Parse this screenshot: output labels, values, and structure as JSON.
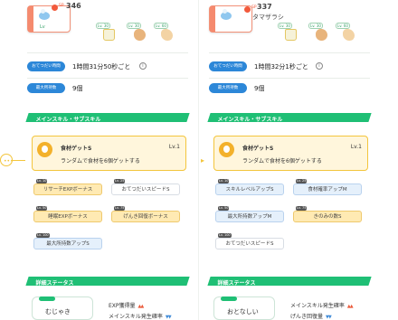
{
  "left": {
    "pokemon": {
      "sp_label": "SP",
      "number": "346",
      "name": "",
      "sub_label": "Lv"
    },
    "foods": [
      {
        "level": "Lv. 30"
      },
      {
        "level": "Lv. 30"
      },
      {
        "level": "Lv. 60"
      }
    ],
    "stats": [
      {
        "label": "おてつだい時間",
        "value": "1時間31分50秒ごと"
      },
      {
        "label": "最大所持数",
        "value": "9個"
      }
    ],
    "section_main": "メインスキル・サブスキル",
    "main_skill": {
      "name": "食材ゲットS",
      "level": "Lv.1",
      "desc": "ランダムで食材を6個ゲットする"
    },
    "sub_skills": [
      {
        "tag": "Lv. 10",
        "label": "リサーチEXPボーナス"
      },
      {
        "tag": "Lv. 25",
        "label": "おてつだいスピードS"
      },
      {
        "tag": "Lv. 50",
        "label": "睡眠EXPボーナス"
      },
      {
        "tag": "Lv. 75",
        "label": "げんき回復ボーナス"
      },
      {
        "tag": "Lv. 100",
        "label": "最大所持数アップS"
      }
    ],
    "section_detail": "詳細ステータス",
    "nature": "むじゃき",
    "traits": [
      {
        "label": "EXP獲得量",
        "arrows": "▲▲",
        "dir": "up"
      },
      {
        "label": "メインスキル発生確率",
        "arrows": "▼▼",
        "dir": "down"
      }
    ]
  },
  "right": {
    "pokemon": {
      "sp_label": "SP",
      "number": "337",
      "name": "タマザラシ"
    },
    "foods": [
      {
        "level": "Lv. 30"
      },
      {
        "level": "Lv. 30"
      },
      {
        "level": "Lv. 60"
      }
    ],
    "stats": [
      {
        "label": "おてつだい時間",
        "value": "1時間32分1秒ごと"
      },
      {
        "label": "最大所持数",
        "value": "9個"
      }
    ],
    "section_main": "メインスキル・サブスキル",
    "main_skill": {
      "name": "食材ゲットS",
      "level": "Lv.1",
      "desc": "ランダムで食材を6個ゲットする"
    },
    "sub_skills": [
      {
        "tag": "Lv. 10",
        "label": "スキルレベルアップS"
      },
      {
        "tag": "Lv. 25",
        "label": "食材確率アップM"
      },
      {
        "tag": "Lv. 50",
        "label": "最大所持数アップM"
      },
      {
        "tag": "Lv. 75",
        "label": "きのみの数S"
      },
      {
        "tag": "Lv. 100",
        "label": "おてつだいスピードS"
      }
    ],
    "section_detail": "詳細ステータス",
    "nature": "おとなしい",
    "traits": [
      {
        "label": "メインスキル発生確率",
        "arrows": "▲▲",
        "dir": "up"
      },
      {
        "label": "げんき回復量",
        "arrows": "▼▼",
        "dir": "down"
      }
    ]
  }
}
